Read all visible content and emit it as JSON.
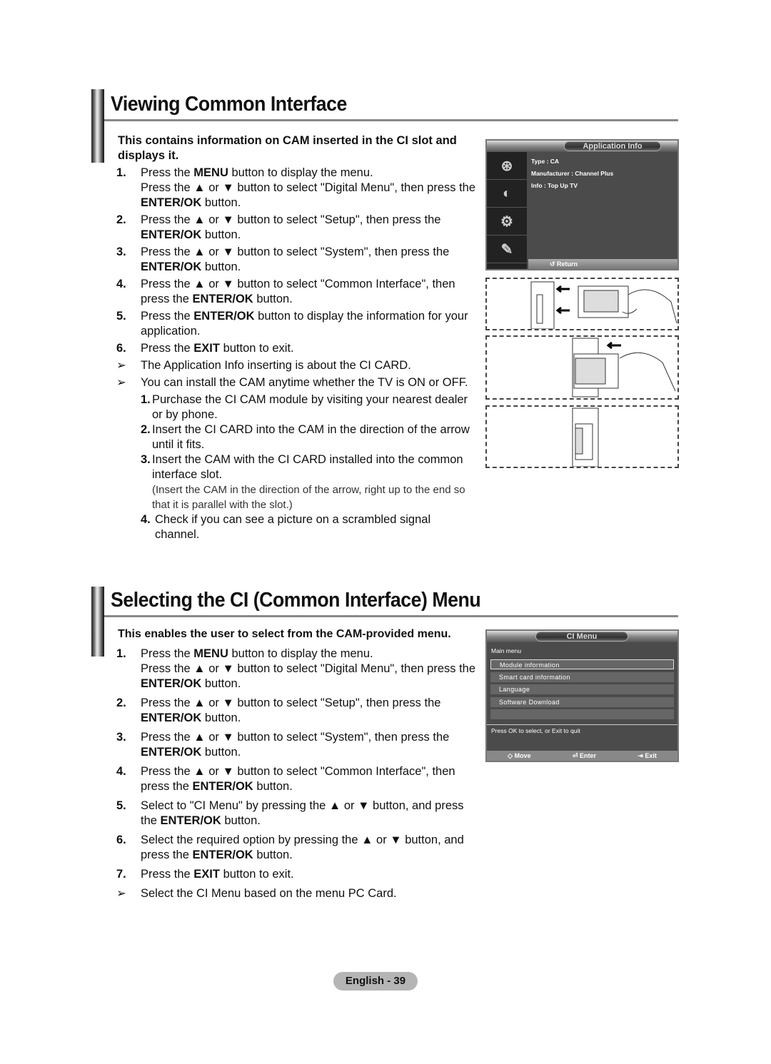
{
  "section1": {
    "title": "Viewing Common Interface",
    "intro": "This contains information on CAM inserted in the CI slot and displays it.",
    "steps": [
      {
        "num": "1.",
        "html": "Press the <b>MENU</b> button to display the menu.<br>Press the ▲ or ▼ button to select \"Digital Menu\", then press the <b>ENTER/OK</b> button."
      },
      {
        "num": "2.",
        "html": "Press the ▲ or ▼ button to select \"Setup\", then press the <b>ENTER/OK</b> button."
      },
      {
        "num": "3.",
        "html": "Press the ▲ or ▼ button to select \"System\", then press the <b>ENTER/OK</b> button."
      },
      {
        "num": "4.",
        "html": "Press the ▲ or ▼ button to select \"Common Interface\", then press the <b>ENTER/OK</b> button."
      },
      {
        "num": "5.",
        "html": "Press the <b>ENTER/OK</b> button to display the information for your application."
      },
      {
        "num": "6.",
        "html": "Press the <b>EXIT</b> button to exit."
      }
    ],
    "notes": [
      "The Application Info inserting is about the CI CARD.",
      "You can install the CAM anytime whether the TV is ON or OFF."
    ],
    "sub_steps": [
      {
        "n": "1.",
        "text": "Purchase the CI CAM module by visiting your nearest dealer or by phone."
      },
      {
        "n": "2.",
        "text": "Insert the CI CARD into the CAM in the direction of the arrow until it fits."
      },
      {
        "n": "3.",
        "text": "Insert the CAM with the CI CARD installed into the common interface slot."
      }
    ],
    "sub_note": "(Insert the CAM in the direction of the arrow, right up to the end so that it is parallel with the slot.)",
    "sub_step4": {
      "n": "4.",
      "text": "Check if you can see a picture on a scrambled signal channel."
    }
  },
  "app_info_osd": {
    "title": "Application Info",
    "lines": [
      "Type : CA",
      "Manufacturer : Channel Plus",
      "Info : Top Up TV"
    ],
    "return_label": "Return",
    "side_icons": [
      "film-reel-icon",
      "satellite-dish-icon",
      "gear-icon",
      "language-icon"
    ]
  },
  "section2": {
    "title": "Selecting the CI (Common Interface) Menu",
    "intro": "This enables the user to select from the CAM-provided menu.",
    "steps": [
      {
        "num": "1.",
        "html": "Press the <b>MENU</b> button to display the menu.<br>Press the ▲ or ▼ button to select \"Digital Menu\", then press the <b>ENTER/OK</b> button."
      },
      {
        "num": "2.",
        "html": "Press the ▲ or ▼ button to select \"Setup\", then press the <b>ENTER/OK</b> button."
      },
      {
        "num": "3.",
        "html": "Press the ▲ or ▼ button to select \"System\", then press the <b>ENTER/OK</b> button."
      },
      {
        "num": "4.",
        "html": "Press the ▲ or ▼ button to select \"Common Interface\", then press the <b>ENTER/OK</b> button."
      },
      {
        "num": "5.",
        "html": "Select to \"CI Menu\" by pressing the ▲ or ▼ button, and press the <b>ENTER/OK</b> button."
      },
      {
        "num": "6.",
        "html": "Select the required option by pressing the ▲ or ▼ button, and press the <b>ENTER/OK</b> button."
      },
      {
        "num": "7.",
        "html": "Press the <b>EXIT</b> button to exit."
      }
    ],
    "note": "Select the CI Menu based on the menu PC Card."
  },
  "ci_menu_osd": {
    "title": "CI Menu",
    "subtitle": "Main menu",
    "items": [
      "Module information",
      "Smart card information",
      "Language",
      "Software Download",
      ""
    ],
    "selected_index": 0,
    "hint": "Press OK to select, or Exit to quit",
    "footer": [
      {
        "icon": "move-icon",
        "glyph": "◇",
        "label": "Move"
      },
      {
        "icon": "enter-icon",
        "glyph": "⏎",
        "label": "Enter"
      },
      {
        "icon": "exit-icon",
        "glyph": "⇥",
        "label": "Exit"
      }
    ]
  },
  "footer": {
    "page_label": "English - 39"
  },
  "note_arrow": "➢"
}
